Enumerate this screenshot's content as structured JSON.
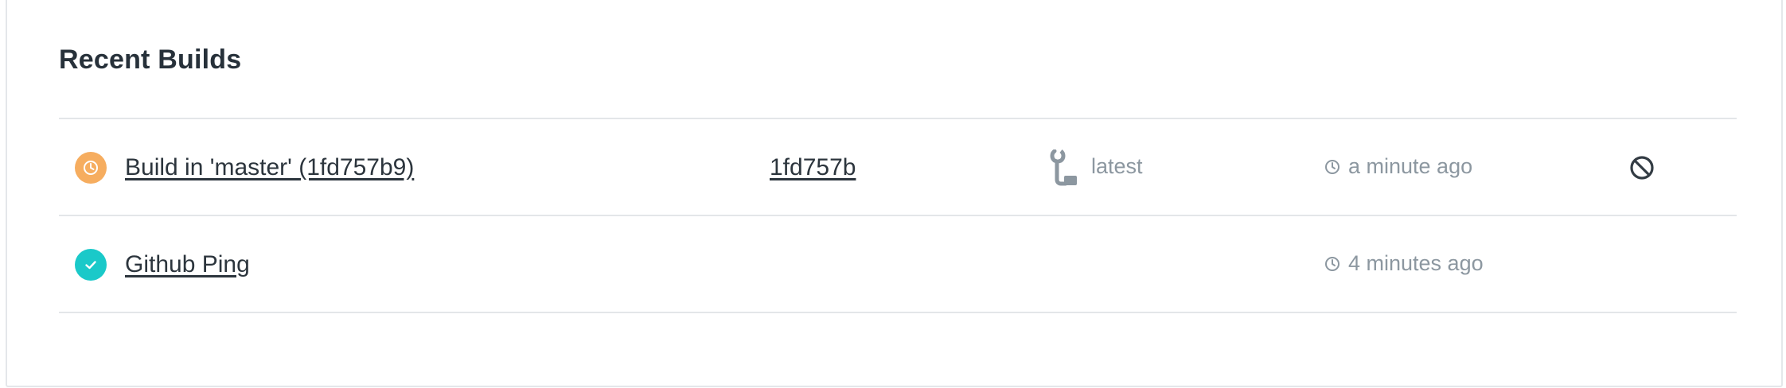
{
  "section": {
    "title": "Recent Builds"
  },
  "builds": [
    {
      "status": "pending",
      "status_color": "#f6ad5f",
      "status_icon": "clock-icon",
      "name": "Build in 'master' (1fd757b9)",
      "commit": "1fd757b",
      "tag_icon": "wrench-branch-icon",
      "tag": "latest",
      "time": "a minute ago",
      "action_icon": "cancel-icon"
    },
    {
      "status": "passed",
      "status_color": "#1ac9c9",
      "status_icon": "check-icon",
      "name": "Github Ping",
      "time": "4 minutes ago"
    }
  ],
  "colors": {
    "title_text": "#27313a",
    "link_text": "#2c353d",
    "muted_text": "#8c97a0",
    "divider": "#e3e6e9"
  }
}
